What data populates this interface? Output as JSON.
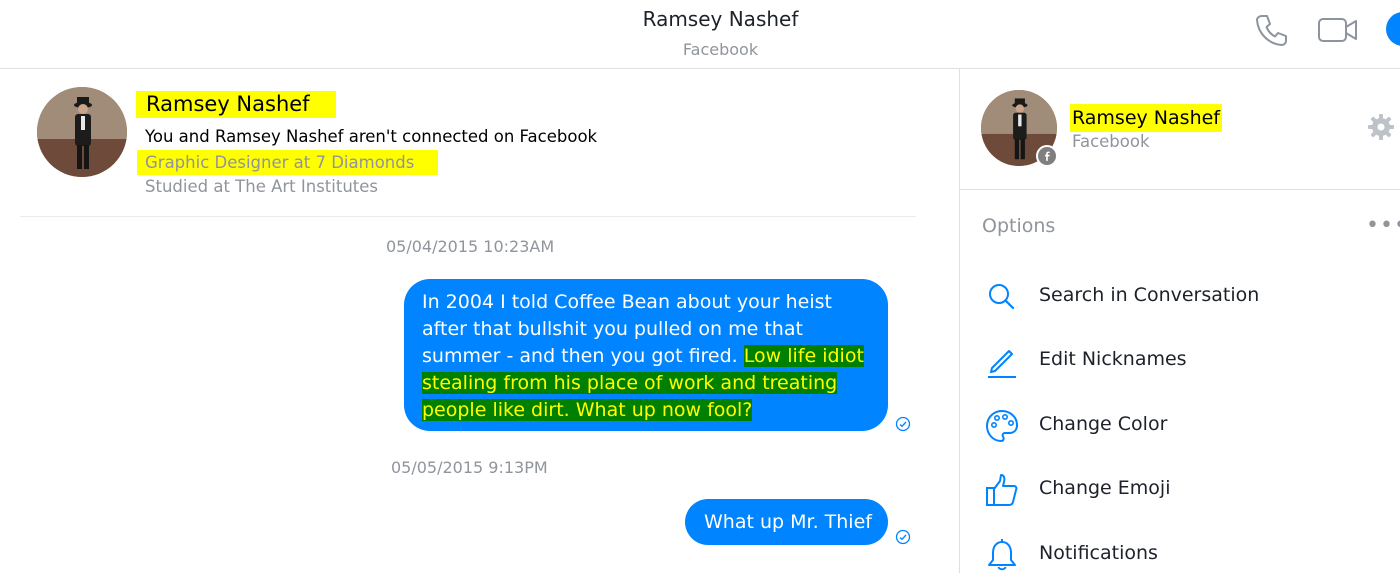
{
  "header": {
    "title": "Ramsey Nashef",
    "subtitle": "Facebook",
    "icons": [
      "phone-icon",
      "video-camera-icon",
      "info-icon"
    ]
  },
  "profile": {
    "name": "Ramsey Nashef",
    "connection": "You and Ramsey Nashef aren't connected on Facebook",
    "job": "Graphic Designer at 7 Diamonds",
    "education": "Studied at The Art Institutes"
  },
  "messages": [
    {
      "timestamp": "05/04/2015 10:23AM",
      "text_plain": "In 2004 I told Coffee Bean about your heist after that bullshit you pulled on me that summer - and then you got fired.  ",
      "text_highlighted": "Low life idiot stealing from his place of work and treating people like dirt.  What up now fool?",
      "status": "sent"
    },
    {
      "timestamp": "05/05/2015 9:13PM",
      "text": "What up Mr. Thief",
      "status": "sent"
    }
  ],
  "info_panel": {
    "name": "Ramsey Nashef",
    "subtitle": "Facebook",
    "options_label": "Options",
    "options": [
      {
        "label": "Search in Conversation",
        "icon": "search-icon"
      },
      {
        "label": "Edit Nicknames",
        "icon": "pencil-icon"
      },
      {
        "label": "Change Color",
        "icon": "palette-icon"
      },
      {
        "label": "Change Emoji",
        "icon": "thumbs-up-icon"
      },
      {
        "label": "Notifications",
        "icon": "bell-icon"
      }
    ]
  },
  "colors": {
    "accent": "#0084ff",
    "highlight_yellow": "#ffff00",
    "highlight_green": "#008000",
    "muted_text": "#90949c"
  }
}
